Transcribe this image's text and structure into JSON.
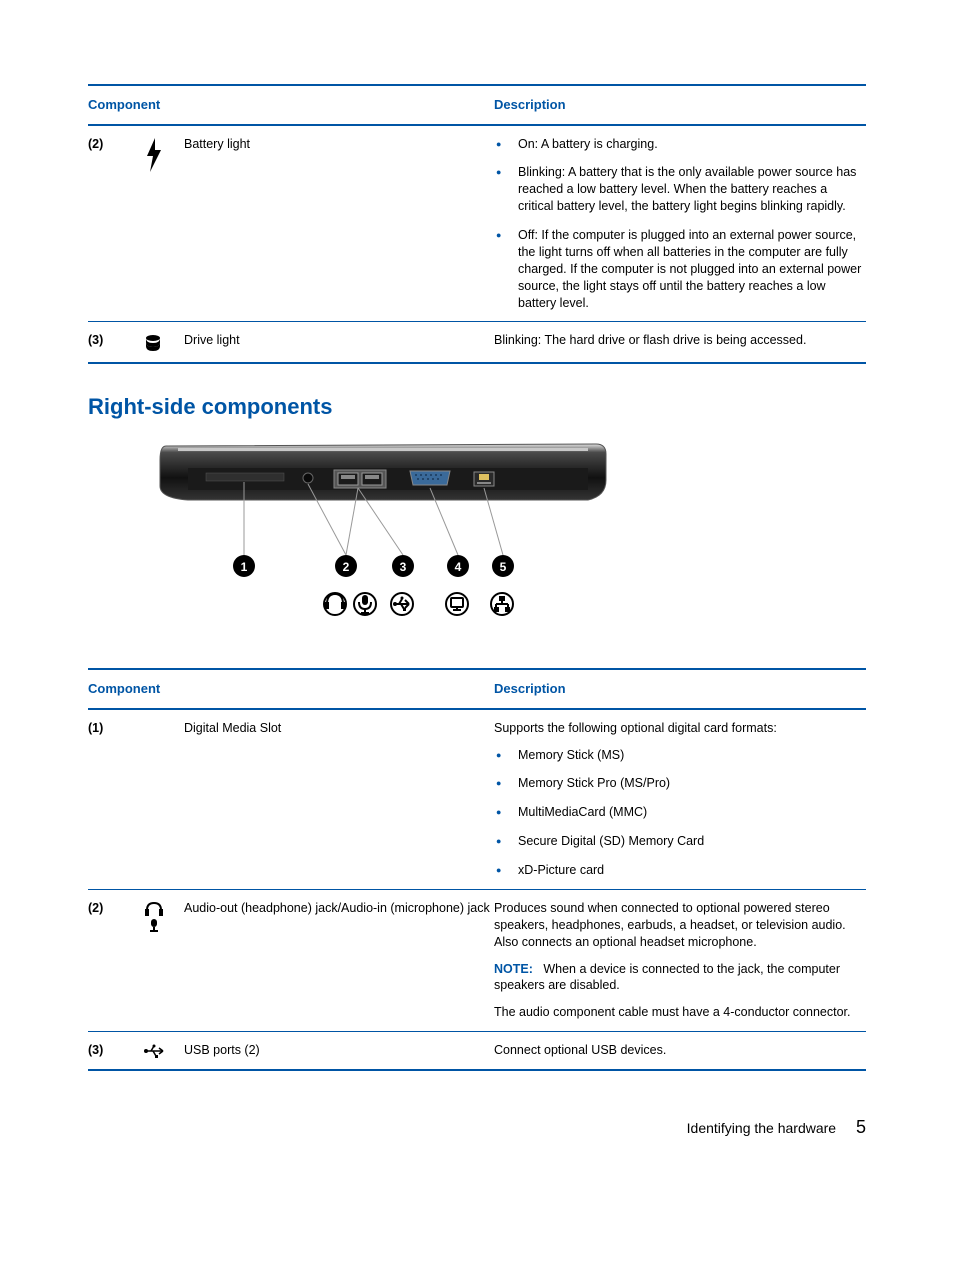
{
  "tables": {
    "top": {
      "headers": {
        "component": "Component",
        "description": "Description"
      },
      "rows": [
        {
          "num": "(2)",
          "name": "Battery light",
          "bullets": [
            "On: A battery is charging.",
            "Blinking: A battery that is the only available power source has reached a low battery level. When the battery reaches a critical battery level, the battery light begins blinking rapidly.",
            "Off: If the computer is plugged into an external power source, the light turns off when all batteries in the computer are fully charged. If the computer is not plugged into an external power source, the light stays off until the battery reaches a low battery level."
          ]
        },
        {
          "num": "(3)",
          "name": "Drive light",
          "desc": "Blinking: The hard drive or flash drive is being accessed."
        }
      ]
    },
    "bottom": {
      "headers": {
        "component": "Component",
        "description": "Description"
      },
      "rows": [
        {
          "num": "(1)",
          "name": "Digital Media Slot",
          "intro": "Supports the following optional digital card formats:",
          "bullets": [
            "Memory Stick (MS)",
            "Memory Stick Pro (MS/Pro)",
            "MultiMediaCard (MMC)",
            "Secure Digital (SD) Memory Card",
            "xD-Picture card"
          ]
        },
        {
          "num": "(2)",
          "name": "Audio-out (headphone) jack/Audio-in (microphone) jack",
          "desc1": "Produces sound when connected to optional powered stereo speakers, headphones, earbuds, a headset, or television audio. Also connects an optional headset microphone.",
          "note_label": "NOTE:",
          "note_text": "When a device is connected to the jack, the computer speakers are disabled.",
          "desc2": "The audio component cable must have a 4-conductor connector."
        },
        {
          "num": "(3)",
          "name": "USB ports (2)",
          "desc": "Connect optional USB devices."
        }
      ]
    }
  },
  "section_heading": "Right-side components",
  "footer": {
    "text": "Identifying the hardware",
    "page": "5"
  }
}
